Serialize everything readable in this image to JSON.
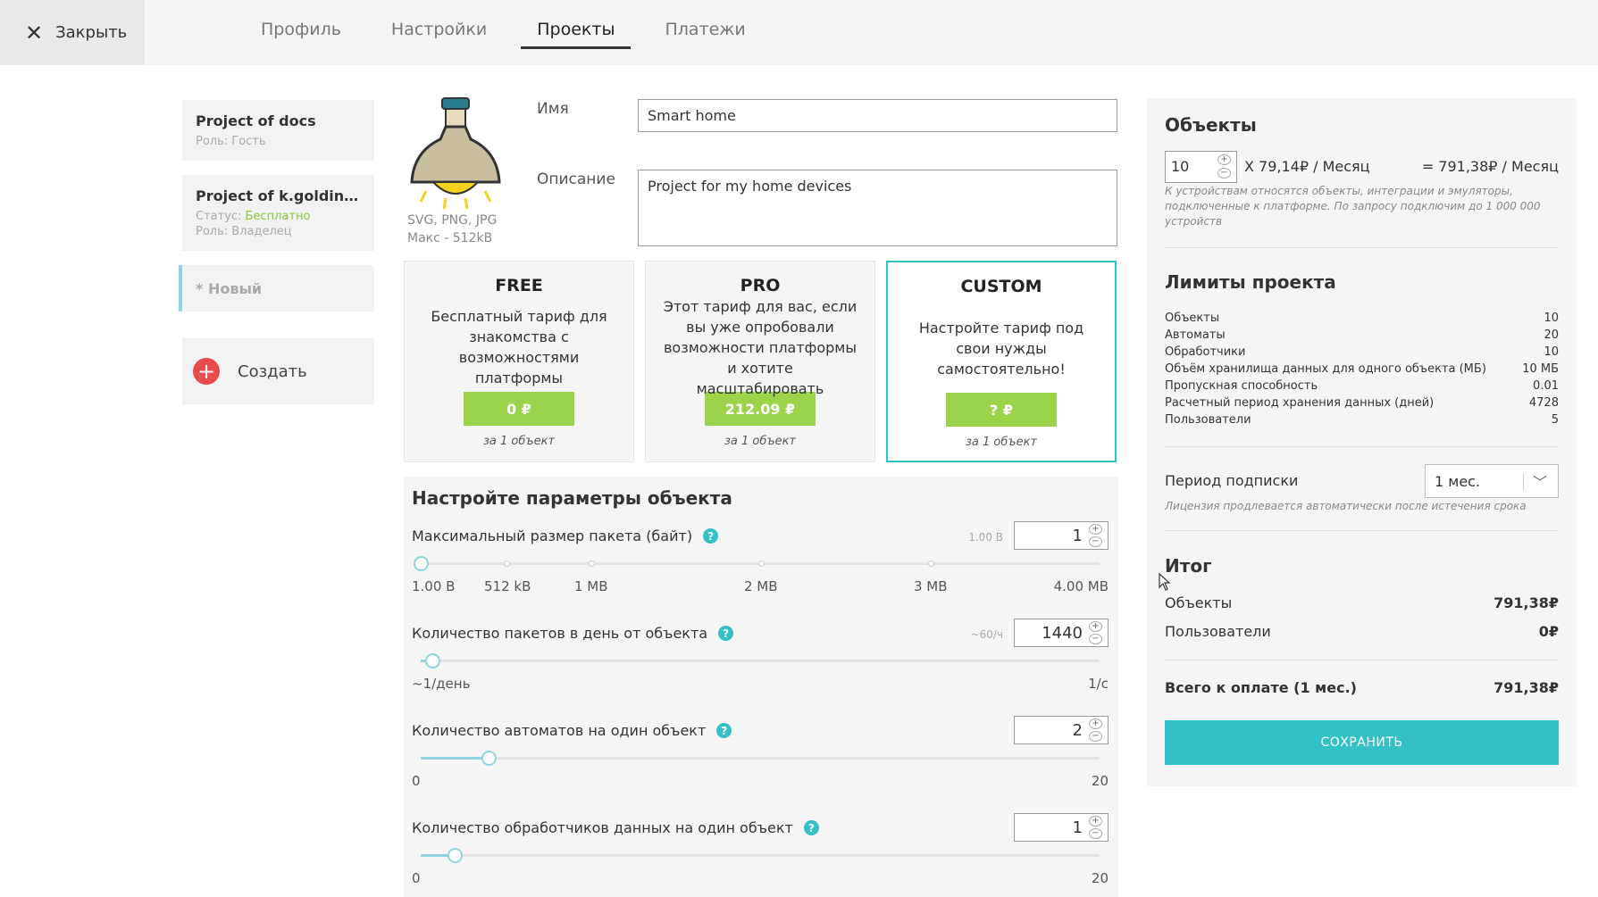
{
  "header": {
    "close_label": "Закрыть",
    "tabs": [
      {
        "label": "Профиль",
        "active": false
      },
      {
        "label": "Настройки",
        "active": false
      },
      {
        "label": "Проекты",
        "active": true
      },
      {
        "label": "Платежи",
        "active": false
      }
    ]
  },
  "sidebar": {
    "projects": [
      {
        "title": "Project of docs",
        "role": "Роль: Гость"
      },
      {
        "title": "Project of k.goldinova...",
        "status_label": "Статус: ",
        "status_value": "Бесплатно",
        "role": "Роль: Владелец"
      }
    ],
    "new_label": "* Новый",
    "create_label": "Создать"
  },
  "project": {
    "avatar_note_formats": "SVG, PNG, JPG",
    "avatar_note_size": "Макс - 512kB",
    "name_label": "Имя",
    "name_value": "Smart home",
    "description_label": "Описание",
    "description_value": "Project for my home devices"
  },
  "plans": [
    {
      "name": "FREE",
      "description": "Бесплатный тариф для знакомства с возможностями платформы",
      "price": "0 ₽",
      "per": "за 1 объект",
      "selected": false
    },
    {
      "name": "PRO",
      "description": "Этот тариф для вас, если вы уже опробовали возможности платформы и хотите масштабировать",
      "price": "212.09 ₽",
      "per": "за 1 объект",
      "selected": false
    },
    {
      "name": "CUSTOM",
      "description": "Настройте тариф под свои нужды самостоятельно!",
      "price": "? ₽",
      "per": "за 1 объект",
      "selected": true
    }
  ],
  "params": {
    "title": "Настройте параметры объекта",
    "items": [
      {
        "label": "Максимальный размер пакета (байт)",
        "hint": "1.00 B",
        "value": "1",
        "fraction": 0.0,
        "ticks": [
          "1.00 B",
          "512 kB",
          "1 MB",
          "2 MB",
          "3 MB",
          "4.00 MB"
        ]
      },
      {
        "label": "Количество пакетов в день от объекта",
        "hint": "~60/ч",
        "value": "1440",
        "fraction": 0.017,
        "ticks": [
          "~1/день",
          "1/с"
        ]
      },
      {
        "label": "Количество автоматов на один объект",
        "hint": "",
        "value": "2",
        "fraction": 0.1,
        "ticks": [
          "0",
          "20"
        ]
      },
      {
        "label": "Количество обработчиков данных на один объект",
        "hint": "",
        "value": "1",
        "fraction": 0.05,
        "ticks": [
          "0",
          "20"
        ]
      }
    ]
  },
  "summary": {
    "objects_title": "Объекты",
    "objects_count": "10",
    "price_per": "X 79,14₽ / Месяц",
    "price_total": "= 791,38₽ / Месяц",
    "objects_note": "К устройствам относятся объекты, интеграции и эмуляторы, подключенные к платформе. По запросу подключим до 1 000 000 устройств",
    "limits_title": "Лимиты проекта",
    "limits": [
      {
        "label": "Объекты",
        "value": "10"
      },
      {
        "label": "Автоматы",
        "value": "20"
      },
      {
        "label": "Обработчики",
        "value": "10"
      },
      {
        "label": "Объём хранилища данных для одного объекта (МБ)",
        "value": "10 МБ"
      },
      {
        "label": "Пропускная способность",
        "value": "0.01"
      },
      {
        "label": "Расчетный период хранения данных (дней)",
        "value": "4728"
      },
      {
        "label": "Пользователи",
        "value": "5"
      }
    ],
    "period_label": "Период подписки",
    "period_value": "1 мес.",
    "period_note": "Лицензия продлевается автоматически после истечения срока",
    "total_title": "Итог",
    "total_rows": [
      {
        "label": "Объекты",
        "value": "791,38₽"
      },
      {
        "label": "Пользователи",
        "value": "0₽"
      }
    ],
    "grand_label": "Всего к оплате (1 мес.)",
    "grand_value": "791,38₽",
    "save_label": "СОХРАНИТЬ"
  },
  "colors": {
    "accent": "#33c1c7",
    "price_green": "#9bd44b",
    "danger": "#e84c4c",
    "free_status": "#8cc63f"
  }
}
